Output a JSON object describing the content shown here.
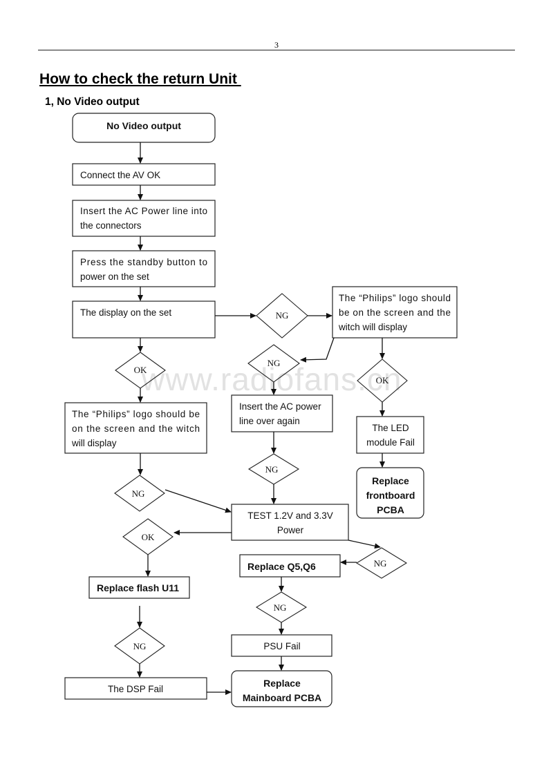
{
  "page": {
    "number": "3",
    "title": "How to check the return Unit ",
    "section": "1, No Video output",
    "watermark": "www.radiofans.cn"
  },
  "flow": {
    "start": "No Video output",
    "step_connect_av": "Connect the AV OK",
    "step_insert_ac": [
      "Insert the AC Power line into",
      "the connectors"
    ],
    "step_standby": [
      "Press the standby button to",
      "power on the set"
    ],
    "step_display": "The display on the set",
    "decision_display_ng": "NG",
    "right_logo_check": [
      "The “Philips” logo should",
      "be on the screen and the",
      "witch will display"
    ],
    "decision_right_ng": "NG",
    "decision_right_ok": "OK",
    "led_fail": [
      "The LED",
      "module Fail"
    ],
    "replace_frontboard": [
      "Replace",
      "frontboard",
      "PCBA"
    ],
    "decision_display_ok": "OK",
    "left_logo_check": [
      "The “Philips” logo should be",
      "on the screen and the witch",
      "will display"
    ],
    "reinsert_ac": [
      "Insert the AC power",
      "line over again"
    ],
    "decision_reinsert_ng": "NG",
    "decision_left_ng": "NG",
    "test_power": [
      "TEST 1.2V and 3.3V",
      "Power"
    ],
    "decision_power_ok": "OK",
    "decision_power_ng": "NG",
    "replace_flash": "Replace flash U11",
    "replace_q5q6": "Replace Q5,Q6",
    "decision_q_ng": "NG",
    "decision_flash_ng": "NG",
    "psu_fail": "PSU Fail",
    "dsp_fail": "The DSP Fail",
    "replace_mainboard": [
      "Replace",
      "Mainboard PCBA"
    ]
  }
}
